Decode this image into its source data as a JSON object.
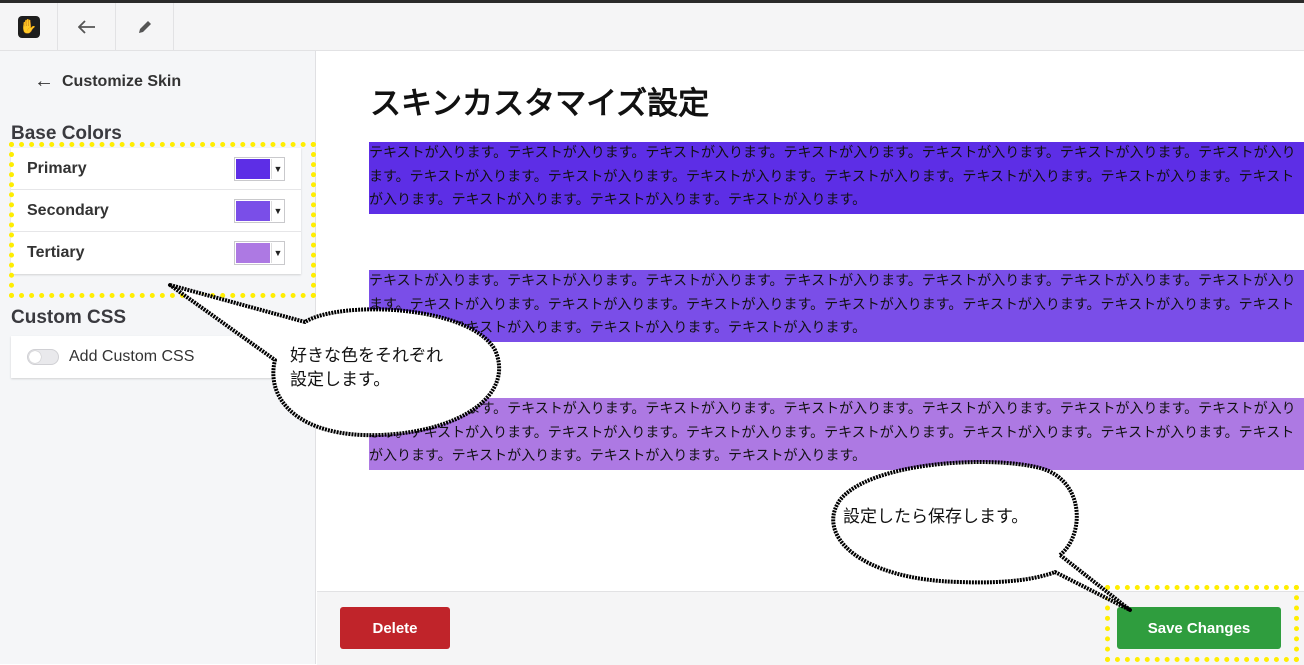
{
  "toolbar": {
    "logo": "concrete-logo-icon",
    "back_icon": "arrow-left-icon",
    "edit_icon": "pencil-icon"
  },
  "sidebar": {
    "back_label": "Customize Skin",
    "base_colors_title": "Base Colors",
    "colors": [
      {
        "label": "Primary",
        "color": "#5d2ee6"
      },
      {
        "label": "Secondary",
        "color": "#7a4ee8"
      },
      {
        "label": "Tertiary",
        "color": "#ad79e3"
      }
    ],
    "custom_css_title": "Custom CSS",
    "custom_css_toggle_label": "Add Custom CSS"
  },
  "main": {
    "title": "スキンカスタマイズ設定",
    "blocks": [
      {
        "text": "テキストが入ります。テキストが入ります。テキストが入ります。テキストが入ります。テキストが入ります。テキストが入ります。テキストが入ります。テキストが入ります。テキストが入ります。テキストが入ります。テキストが入ります。テキストが入ります。テキストが入ります。テキストが入ります。テキストが入ります。テキストが入ります。テキストが入ります。",
        "bg": "#5d2ee6"
      },
      {
        "text": "テキストが入ります。テキストが入ります。テキストが入ります。テキストが入ります。テキストが入ります。テキストが入ります。テキストが入ります。テキストが入ります。テキストが入ります。テキストが入ります。テキストが入ります。テキストが入ります。テキストが入ります。テキストが入ります。テキストが入ります。テキストが入ります。テキストが入ります。",
        "bg": "#7a4ee8"
      },
      {
        "text": "テキストが入ります。テキストが入ります。テキストが入ります。テキストが入ります。テキストが入ります。テキストが入ります。テキストが入ります。テキストが入ります。テキストが入ります。テキストが入ります。テキストが入ります。テキストが入ります。テキストが入ります。テキストが入ります。テキストが入ります。テキストが入ります。テキストが入ります。",
        "bg": "#ad79e3"
      }
    ]
  },
  "footer": {
    "delete_label": "Delete",
    "save_label": "Save Changes"
  },
  "callouts": {
    "colors_note_line1": "好きな色をそれぞれ",
    "colors_note_line2": "設定します。",
    "save_note": "設定したら保存します。"
  },
  "colors": {
    "delete": "#c0242a",
    "save": "#2f9d3e",
    "highlight": "#ffee00"
  }
}
